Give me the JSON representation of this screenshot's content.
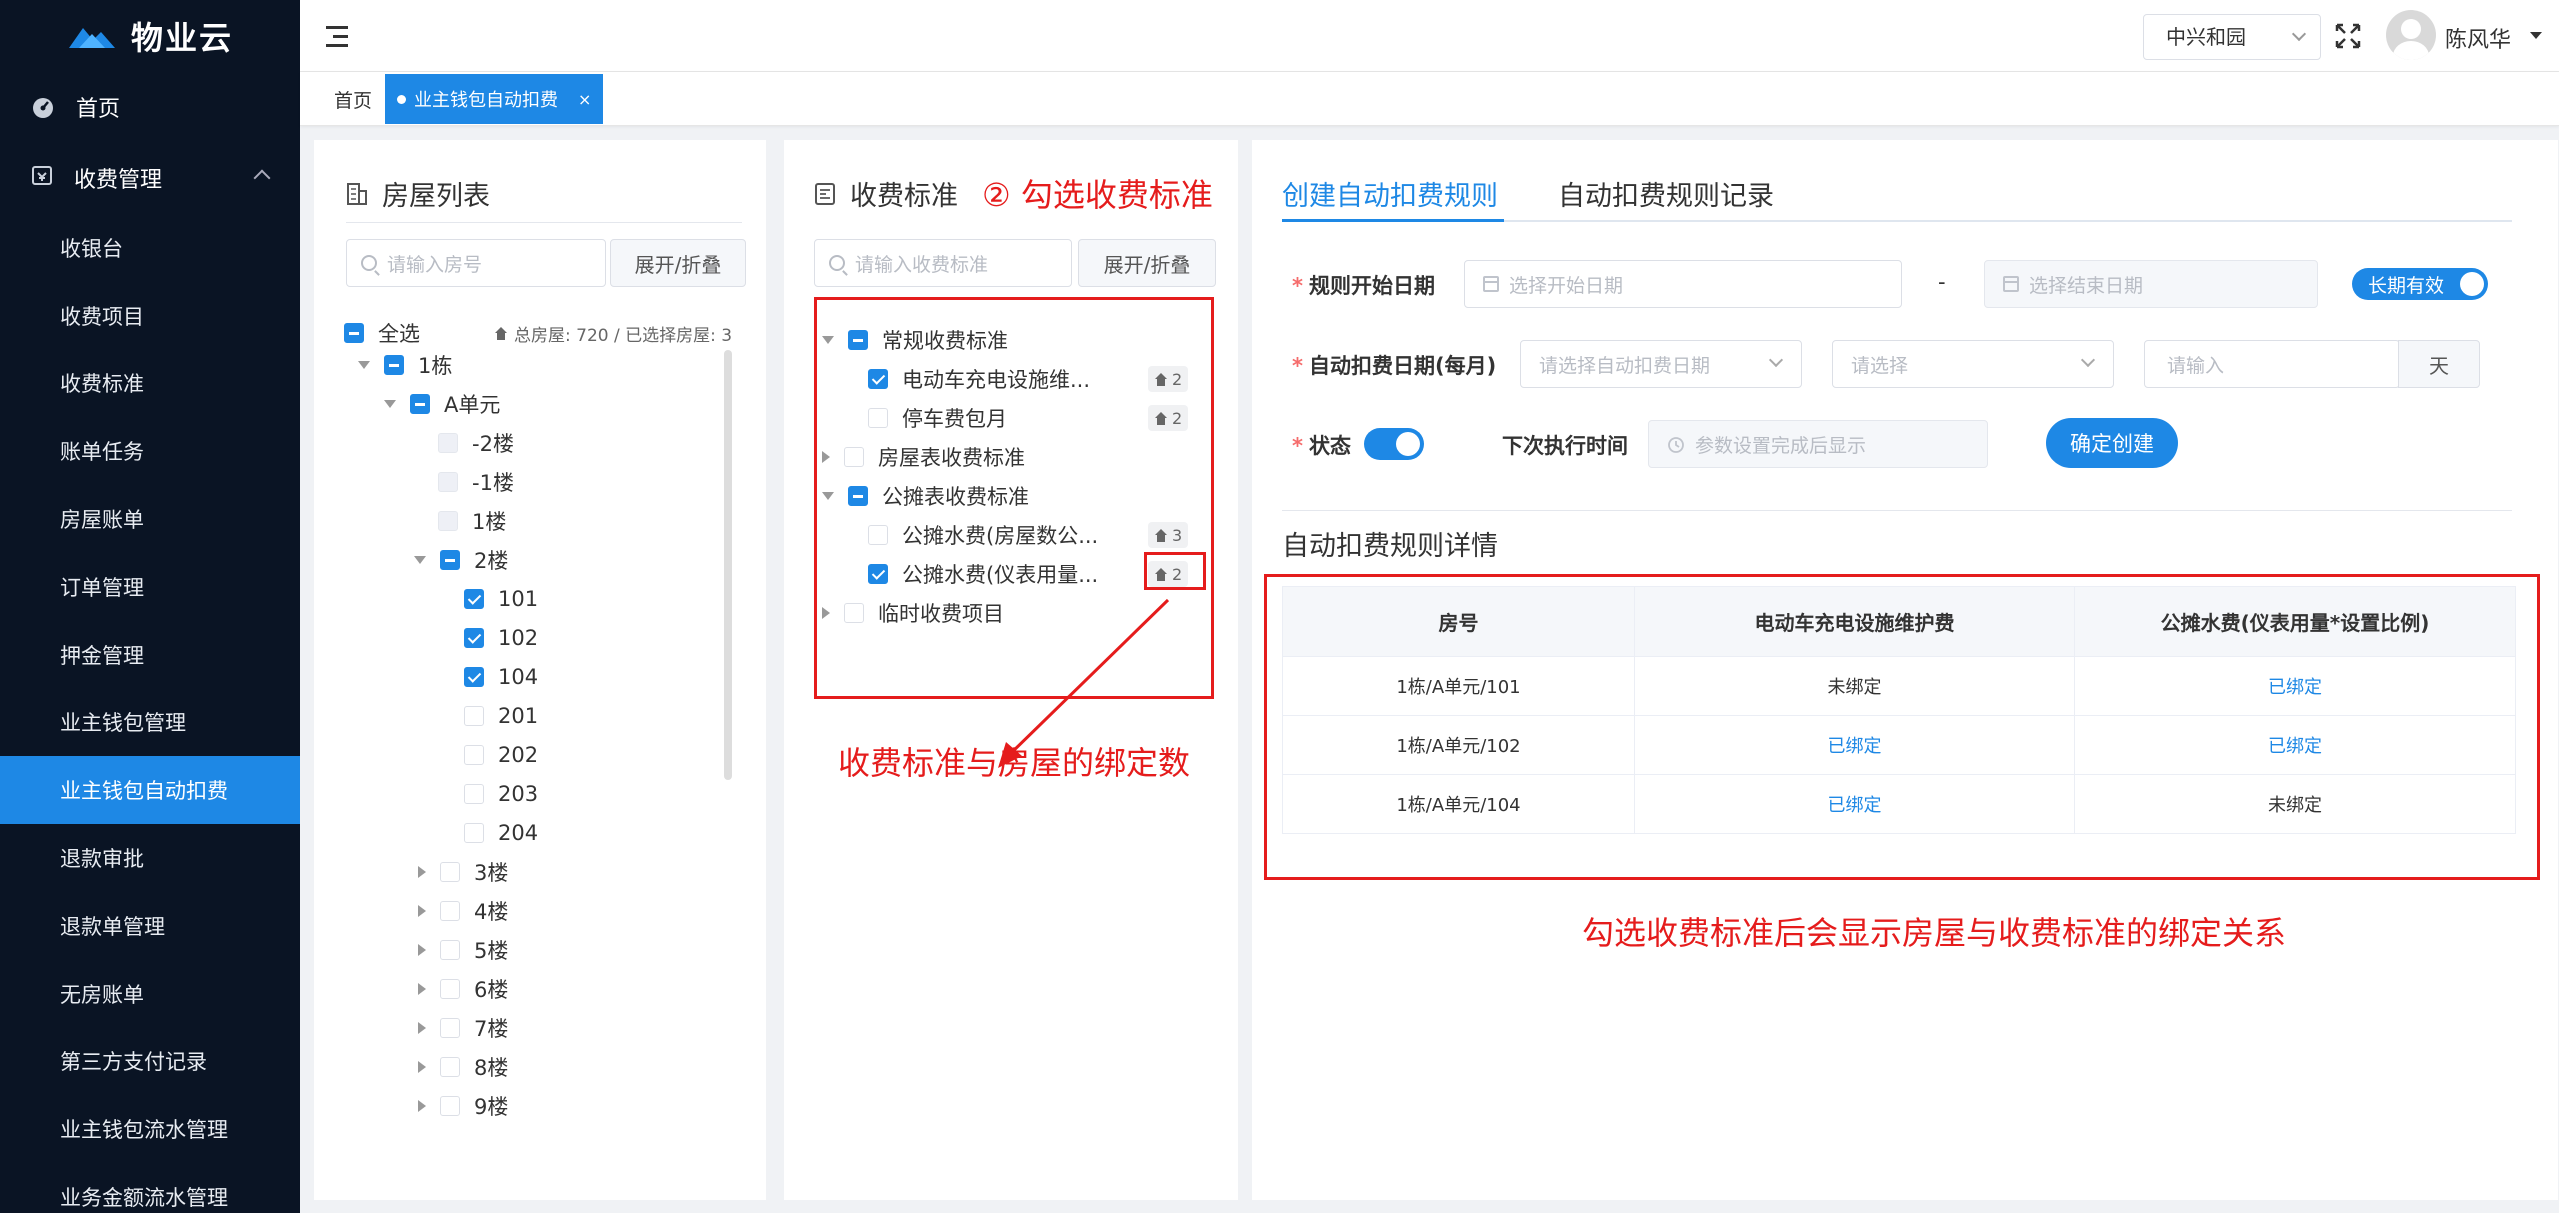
{
  "app": {
    "name": "物业云"
  },
  "sidebar": {
    "home": "首页",
    "group": "收费管理",
    "items": [
      {
        "label": "收银台",
        "active": false
      },
      {
        "label": "收费项目",
        "active": false
      },
      {
        "label": "收费标准",
        "active": false
      },
      {
        "label": "账单任务",
        "active": false
      },
      {
        "label": "房屋账单",
        "active": false
      },
      {
        "label": "订单管理",
        "active": false
      },
      {
        "label": "押金管理",
        "active": false
      },
      {
        "label": "业主钱包管理",
        "active": false
      },
      {
        "label": "业主钱包自动扣费",
        "active": true
      },
      {
        "label": "退款审批",
        "active": false
      },
      {
        "label": "退款单管理",
        "active": false
      },
      {
        "label": "无房账单",
        "active": false
      },
      {
        "label": "第三方支付记录",
        "active": false
      },
      {
        "label": "业主钱包流水管理",
        "active": false
      },
      {
        "label": "业务金额流水管理",
        "active": false
      }
    ]
  },
  "header": {
    "community": "中兴和园",
    "user": "陈风华"
  },
  "tabs": {
    "home": "首页",
    "active": "业主钱包自动扣费",
    "close": "×"
  },
  "house_panel": {
    "title": "房屋列表",
    "search_placeholder": "请输入房号",
    "toggle": "展开/折叠",
    "select_all": "全选",
    "stats": "总房屋: 720 / 已选择房屋: 3",
    "tree": [
      {
        "label": "1栋"
      },
      {
        "label": "A单元"
      },
      {
        "label": "-2楼"
      },
      {
        "label": "-1楼"
      },
      {
        "label": "1楼"
      },
      {
        "label": "2楼"
      },
      {
        "label": "101"
      },
      {
        "label": "102"
      },
      {
        "label": "104"
      },
      {
        "label": "201"
      },
      {
        "label": "202"
      },
      {
        "label": "203"
      },
      {
        "label": "204"
      },
      {
        "label": "3楼"
      },
      {
        "label": "4楼"
      },
      {
        "label": "5楼"
      },
      {
        "label": "6楼"
      },
      {
        "label": "7楼"
      },
      {
        "label": "8楼"
      },
      {
        "label": "9楼"
      }
    ]
  },
  "fee_panel": {
    "title": "收费标准",
    "annotation_step": "② 勾选收费标准",
    "search_placeholder": "请输入收费标准",
    "toggle": "展开/折叠",
    "tree": [
      {
        "label": "常规收费标准"
      },
      {
        "label": "电动车充电设施维...",
        "count": "2"
      },
      {
        "label": "停车费包月",
        "count": "2"
      },
      {
        "label": "房屋表收费标准"
      },
      {
        "label": "公摊表收费标准"
      },
      {
        "label": "公摊水费(房屋数公...",
        "count": "3"
      },
      {
        "label": "公摊水费(仪表用量...",
        "count": "2"
      },
      {
        "label": "临时收费项目"
      }
    ],
    "annotation_bind": "收费标准与房屋的绑定数"
  },
  "rule_panel": {
    "tab_create": "创建自动扣费规则",
    "tab_records": "自动扣费规则记录",
    "start_label": "规则开始日期",
    "start_placeholder": "选择开始日期",
    "dash": "-",
    "end_placeholder": "选择结束日期",
    "long_term": "长期有效",
    "deduct_label": "自动扣费日期(每月)",
    "deduct_placeholder": "请选择自动扣费日期",
    "select_placeholder": "请选择",
    "input_placeholder": "请输入",
    "unit": "天",
    "status_label": "状态",
    "next_label": "下次执行时间",
    "next_placeholder": "参数设置完成后显示",
    "submit": "确定创建",
    "detail_title": "自动扣费规则详情",
    "columns": [
      "房号",
      "电动车充电设施维护费",
      "公摊水费(仪表用量*设置比例)"
    ],
    "rows": [
      [
        "1栋/A单元/101",
        "未绑定",
        "已绑定"
      ],
      [
        "1栋/A单元/102",
        "已绑定",
        "已绑定"
      ],
      [
        "1栋/A单元/104",
        "已绑定",
        "未绑定"
      ]
    ],
    "annotation": "勾选收费标准后会显示房屋与收费标准的绑定关系"
  },
  "colors": {
    "primary": "#1e88e5",
    "sidebar": "#0a1424",
    "annotation": "#e51c1c"
  }
}
